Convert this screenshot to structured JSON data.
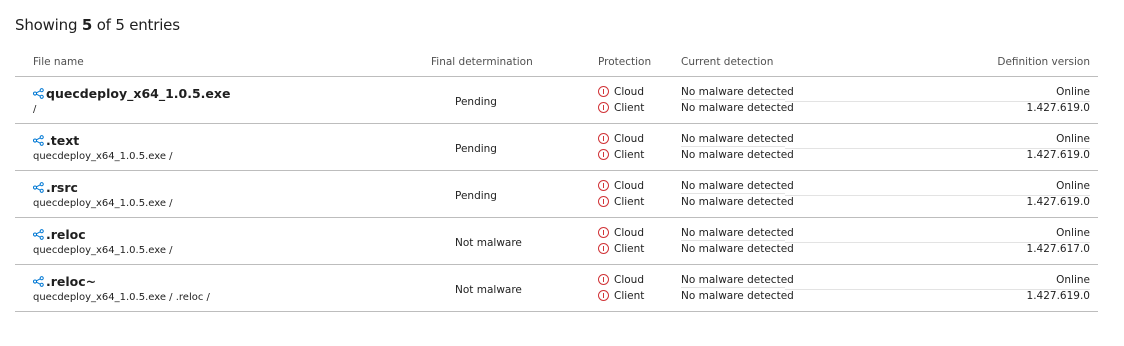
{
  "summary": {
    "prefix": "Showing",
    "count": "5",
    "suffix": "of 5 entries"
  },
  "columns": {
    "file_name": "File name",
    "final_determination": "Final determination",
    "protection": "Protection",
    "current_detection": "Current detection",
    "definition_version": "Definition version"
  },
  "rows": [
    {
      "name": "quecdeploy_x64_1.0.5.exe",
      "path": "/",
      "determination": "Pending",
      "protection": [
        "Cloud",
        "Client"
      ],
      "detection": [
        "No malware detected",
        "No malware detected"
      ],
      "definition": [
        "Online",
        "1.427.619.0"
      ]
    },
    {
      "name": ".text",
      "path": "quecdeploy_x64_1.0.5.exe /",
      "determination": "Pending",
      "protection": [
        "Cloud",
        "Client"
      ],
      "detection": [
        "No malware detected",
        "No malware detected"
      ],
      "definition": [
        "Online",
        "1.427.619.0"
      ]
    },
    {
      "name": ".rsrc",
      "path": "quecdeploy_x64_1.0.5.exe /",
      "determination": "Pending",
      "protection": [
        "Cloud",
        "Client"
      ],
      "detection": [
        "No malware detected",
        "No malware detected"
      ],
      "definition": [
        "Online",
        "1.427.619.0"
      ]
    },
    {
      "name": ".reloc",
      "path": "quecdeploy_x64_1.0.5.exe /",
      "determination": "Not malware",
      "protection": [
        "Cloud",
        "Client"
      ],
      "detection": [
        "No malware detected",
        "No malware detected"
      ],
      "definition": [
        "Online",
        "1.427.617.0"
      ]
    },
    {
      "name": ".reloc~",
      "path": "quecdeploy_x64_1.0.5.exe / .reloc /",
      "determination": "Not malware",
      "protection": [
        "Cloud",
        "Client"
      ],
      "detection": [
        "No malware detected",
        "No malware detected"
      ],
      "definition": [
        "Online",
        "1.427.619.0"
      ]
    }
  ],
  "icons": {
    "file": "share-nodes-icon",
    "status": "warning-circle-icon"
  },
  "colors": {
    "icon_blue": "#0078d4",
    "warning_red": "#d13438",
    "divider": "#bdbdbd"
  }
}
